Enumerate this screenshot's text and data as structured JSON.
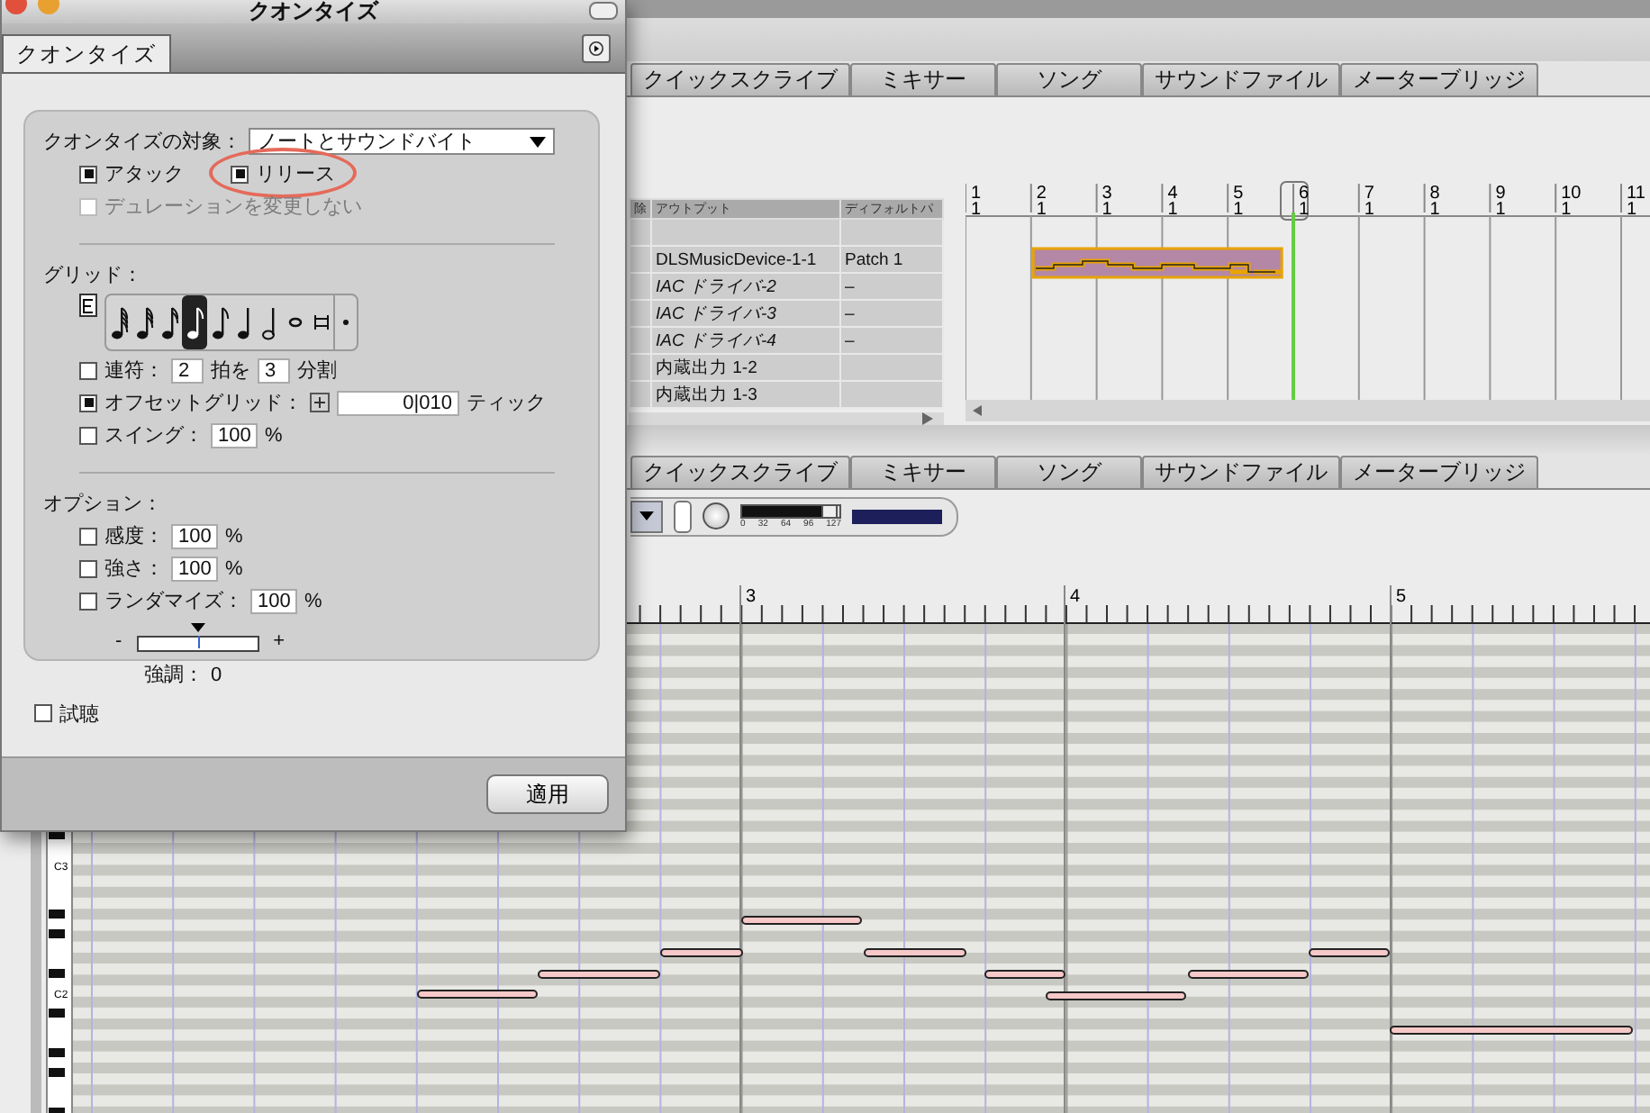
{
  "tabs_top": [
    {
      "label": "クイックスクライブ",
      "selected": false
    },
    {
      "label": "ミキサー",
      "selected": false
    },
    {
      "label": "ソング",
      "selected": false
    },
    {
      "label": "サウンドファイル",
      "selected": false
    },
    {
      "label": "メーターブリッジ",
      "selected": false
    }
  ],
  "tracks": {
    "columns": [
      "除",
      "アウトプット",
      "ディフォルトパ"
    ],
    "rows": [
      {
        "output": "DLSMusicDevice-1-1",
        "patch": "Patch 1",
        "italic": false
      },
      {
        "output": "IAC ドライバ-2",
        "patch": "–",
        "italic": true
      },
      {
        "output": "IAC ドライバ-3",
        "patch": "–",
        "italic": true
      },
      {
        "output": "IAC ドライバ-4",
        "patch": "–",
        "italic": true
      },
      {
        "output": "内蔵出力 1-2",
        "italic": false
      },
      {
        "output": "内蔵出力 1-3",
        "italic": false
      }
    ]
  },
  "arrange_ruler": [
    {
      "bar": "1",
      "beat": "1",
      "current": false
    },
    {
      "bar": "2",
      "beat": "1",
      "current": false
    },
    {
      "bar": "3",
      "beat": "1",
      "current": false
    },
    {
      "bar": "4",
      "beat": "1",
      "current": false
    },
    {
      "bar": "5",
      "beat": "1",
      "current": false
    },
    {
      "bar": "6",
      "beat": "1",
      "current": true
    },
    {
      "bar": "7",
      "beat": "1",
      "current": false
    },
    {
      "bar": "8",
      "beat": "1",
      "current": false
    },
    {
      "bar": "9",
      "beat": "1",
      "current": false
    },
    {
      "bar": "10",
      "beat": "1",
      "current": false
    },
    {
      "bar": "11",
      "beat": "1",
      "current": false
    }
  ],
  "tabs_bottom": [
    {
      "label": "クイックスクライブ",
      "selected": false
    },
    {
      "label": "ミキサー",
      "selected": false
    },
    {
      "label": "ソング",
      "selected": false
    },
    {
      "label": "サウンドファイル",
      "selected": false
    },
    {
      "label": "メーターブリッジ",
      "selected": false
    }
  ],
  "velocity": {
    "level": 0.88,
    "scale": [
      "0",
      "32",
      "64",
      "96",
      "127"
    ]
  },
  "piano_ruler": [
    "3",
    "4",
    "5"
  ],
  "keyboard_labels": [
    "C3",
    "C2"
  ],
  "dialog": {
    "title": "クオンタイズ",
    "tab": {
      "label": "クオンタイズ",
      "selected": true
    },
    "target": {
      "label": "クオンタイズの対象：",
      "value": "ノートとサウンドバイト"
    },
    "target_options": [
      {
        "label": "アタック",
        "checked": true,
        "disabled": false,
        "highlighted": false
      },
      {
        "label": "リリース",
        "checked": true,
        "disabled": false,
        "highlighted": true
      },
      {
        "label": "デュレーションを変更しない",
        "checked": false,
        "disabled": true,
        "highlighted": false
      }
    ],
    "grid": {
      "label": "グリッド：",
      "note_values": [
        {
          "kind": "flag4",
          "selected": false
        },
        {
          "kind": "flag3",
          "selected": false
        },
        {
          "kind": "flag2",
          "selected": false
        },
        {
          "kind": "flag1",
          "selected": true
        },
        {
          "kind": "eighth",
          "selected": false
        },
        {
          "kind": "quarter",
          "selected": false
        },
        {
          "kind": "half",
          "selected": false
        },
        {
          "kind": "whole",
          "selected": false
        },
        {
          "kind": "breve",
          "selected": false
        },
        {
          "kind": "dot",
          "selected": false
        }
      ],
      "tuplet": {
        "label": "連符：",
        "checked": false,
        "beats": "2",
        "beats_label": "拍を",
        "divide": "3",
        "divide_label": "分割"
      },
      "offset": {
        "label": "オフセットグリッド：",
        "checked": true,
        "value": "0|010",
        "unit": "ティック"
      },
      "swing": {
        "label": "スイング：",
        "checked": false,
        "value": "100",
        "unit": "%"
      }
    },
    "options": {
      "label": "オプション：",
      "items": [
        {
          "label": "感度：",
          "checked": false,
          "value": "100",
          "unit": "%"
        },
        {
          "label": "強さ：",
          "checked": false,
          "value": "100",
          "unit": "%"
        },
        {
          "label": "ランダマイズ：",
          "checked": false,
          "value": "100",
          "unit": "%"
        }
      ],
      "emphasis": {
        "minus": "-",
        "plus": "+",
        "level": 0.5,
        "label": "強調：",
        "value": "0"
      }
    },
    "preview": {
      "label": "試聴",
      "checked": false
    },
    "apply_button": "適用"
  }
}
